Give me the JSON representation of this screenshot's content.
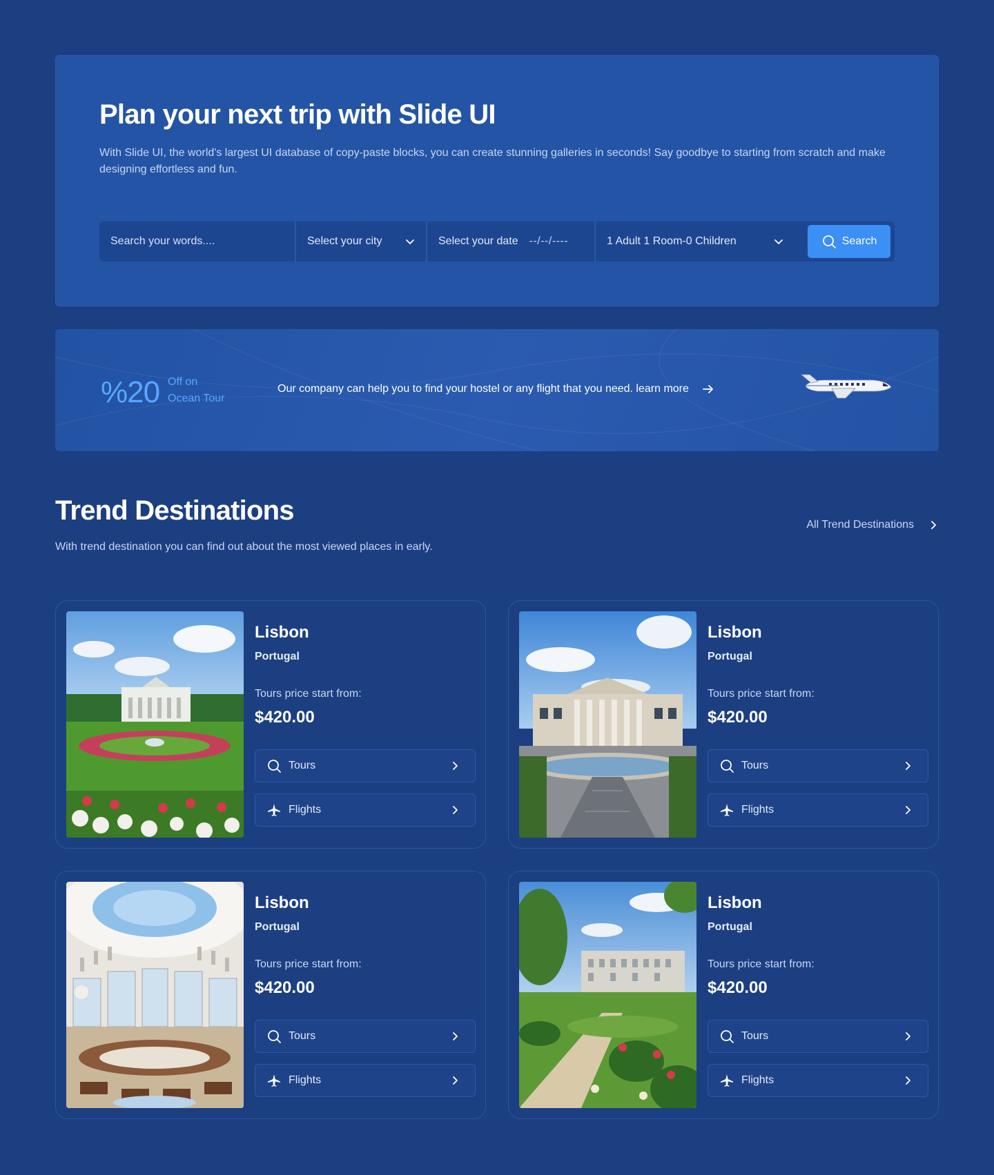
{
  "hero": {
    "title": "Plan your next trip with Slide UI",
    "description": "With Slide UI, the world's largest UI database of copy-paste blocks, you can create stunning galleries in seconds! Say goodbye to starting from scratch and make designing effortless and fun.",
    "search": {
      "words_placeholder": "Search your words....",
      "city_label": "Select your city",
      "date_label": "Select your date",
      "date_value": "--/--/----",
      "guests_label": "1 Adult 1 Room-0 Children",
      "button_label": "Search"
    }
  },
  "promo": {
    "percent": "%20",
    "off_line1": "Off on",
    "off_line2": "Ocean Tour",
    "text": "Our company can help you to find your hostel or any flight that you need. learn more"
  },
  "trend": {
    "title": "Trend Destinations",
    "subtitle": "With trend destination you can find out about the most viewed places in early.",
    "all_link": "All Trend Destinations",
    "cards": [
      {
        "city": "Lisbon",
        "country": "Portugal",
        "price_label": "Tours price start from:",
        "price": "$420.00",
        "tours_label": "Tours",
        "flights_label": "Flights"
      },
      {
        "city": "Lisbon",
        "country": "Portugal",
        "price_label": "Tours price start from:",
        "price": "$420.00",
        "tours_label": "Tours",
        "flights_label": "Flights"
      },
      {
        "city": "Lisbon",
        "country": "Portugal",
        "price_label": "Tours price start from:",
        "price": "$420.00",
        "tours_label": "Tours",
        "flights_label": "Flights"
      },
      {
        "city": "Lisbon",
        "country": "Portugal",
        "price_label": "Tours price start from:",
        "price": "$420.00",
        "tours_label": "Tours",
        "flights_label": "Flights"
      }
    ]
  },
  "colors": {
    "page_bg": "#1c3f82",
    "hero_bg": "#2354a6",
    "accent": "#3b8ff5",
    "promo_accent": "#58a7ff"
  },
  "icons": [
    "search-icon",
    "chevron-down-icon",
    "arrow-right-icon",
    "chevron-right-icon",
    "plane-icon",
    "jet-illustration"
  ]
}
